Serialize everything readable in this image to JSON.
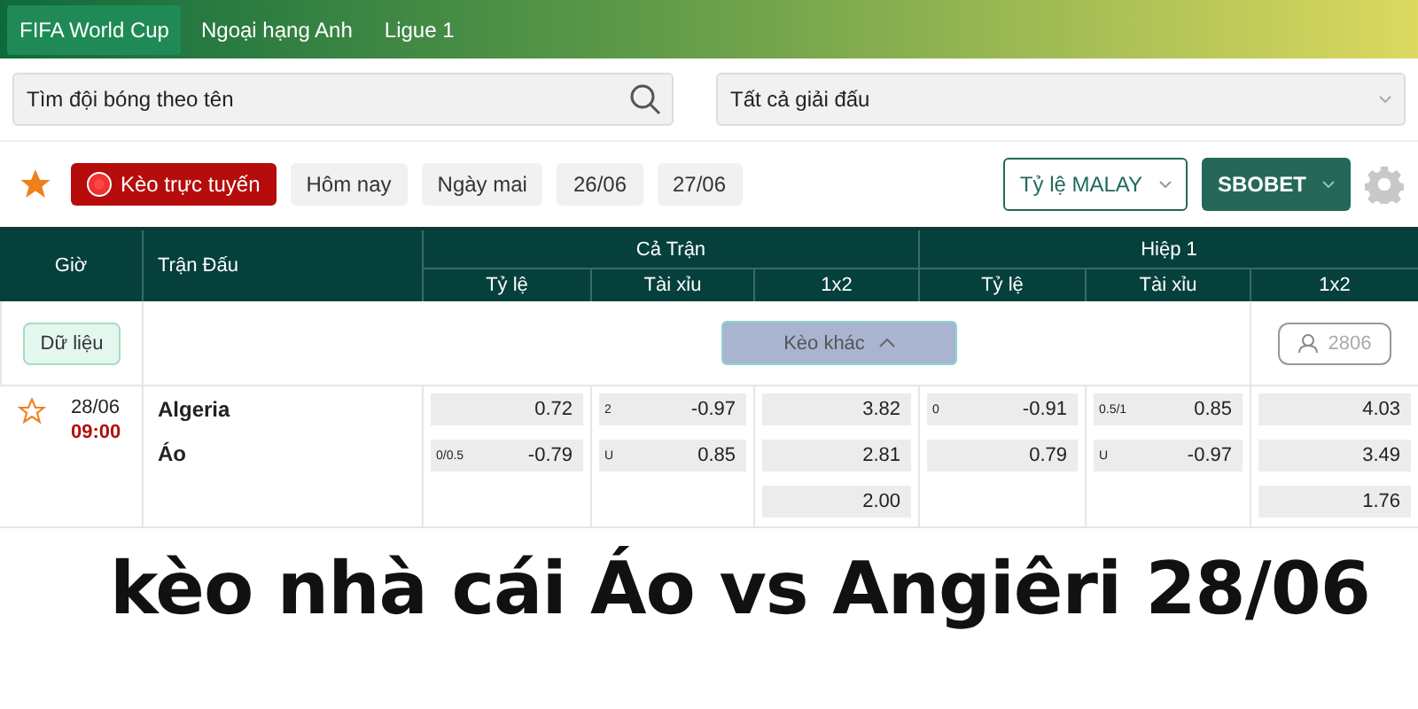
{
  "tabs": [
    {
      "label": "FIFA World Cup",
      "selected": true
    },
    {
      "label": "Ngoại hạng Anh",
      "selected": false
    },
    {
      "label": "Ligue 1",
      "selected": false
    }
  ],
  "search": {
    "placeholder": "Tìm đội bóng theo tên"
  },
  "league_select": {
    "value": "Tất cả giải đấu"
  },
  "filters": [
    {
      "label": "Kèo trực tuyến",
      "kind": "live",
      "selected": true
    },
    {
      "label": "Hôm nay",
      "kind": "date",
      "selected": false
    },
    {
      "label": "Ngày mai",
      "kind": "date",
      "selected": false
    },
    {
      "label": "26/06",
      "kind": "date",
      "selected": false
    },
    {
      "label": "27/06",
      "kind": "date",
      "selected": false
    }
  ],
  "odds_format": "Tỷ lệ MALAY",
  "bookmaker": "SBOBET",
  "table": {
    "time_heading": "Giờ",
    "match_heading": "Trận Đấu",
    "groups": [
      {
        "label": "Cả Trận",
        "columns": [
          "Tỷ lệ",
          "Tài xỉu",
          "1x2"
        ]
      },
      {
        "label": "Hiệp 1",
        "columns": [
          "Tỷ lệ",
          "Tài xỉu",
          "1x2"
        ]
      }
    ],
    "data_button": "Dữ liệu",
    "more_button": "Kèo khác",
    "viewers": "2806",
    "match": {
      "favorite": false,
      "date": "28/06",
      "time": "09:00",
      "home": "Algeria",
      "away": "Áo",
      "markets": [
        [
          {
            "value": "0.72"
          },
          {
            "line": "0/0.5",
            "value": "-0.79"
          }
        ],
        [
          {
            "line": "2",
            "value": "-0.97"
          },
          {
            "line": "U",
            "value": "0.85"
          }
        ],
        [
          {
            "value": "3.82"
          },
          {
            "value": "2.81"
          },
          {
            "value": "2.00"
          }
        ],
        [
          {
            "line": "0",
            "value": "-0.91"
          },
          {
            "value": "0.79"
          }
        ],
        [
          {
            "line": "0.5/1",
            "value": "0.85"
          },
          {
            "line": "U",
            "value": "-0.97"
          }
        ],
        [
          {
            "value": "4.03"
          },
          {
            "value": "3.49"
          },
          {
            "value": "1.76"
          }
        ]
      ]
    }
  },
  "caption": "kèo nhà cái Áo vs Angiêri 28/06"
}
